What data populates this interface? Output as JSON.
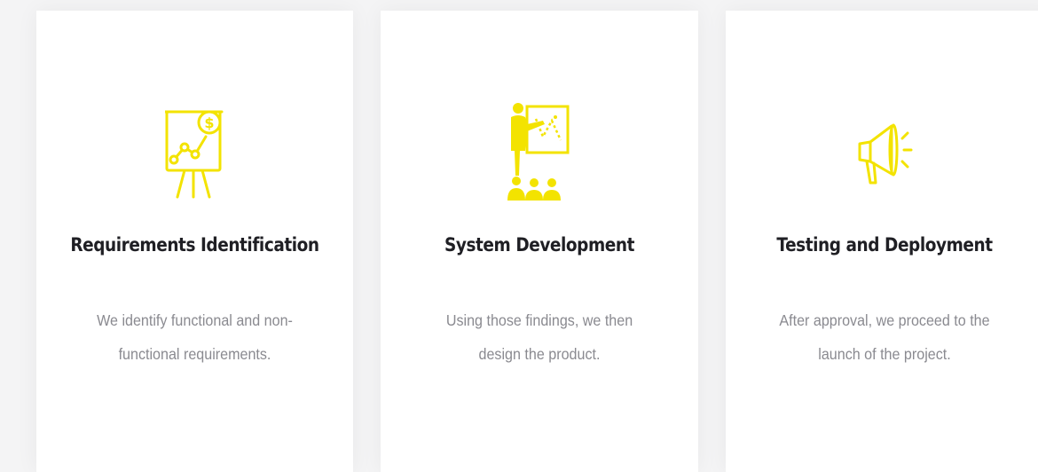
{
  "accent_color": "#f3e300",
  "cards": [
    {
      "icon": "presentation-chart-dollar-icon",
      "title": "Requirements Identification",
      "description": "We identify functional and non-functional requirements."
    },
    {
      "icon": "presenter-audience-icon",
      "title": "System Development",
      "description": "Using those findings, we then design the product."
    },
    {
      "icon": "megaphone-icon",
      "title": "Testing and Deployment",
      "description": "After approval, we proceed to the launch of the project."
    }
  ]
}
